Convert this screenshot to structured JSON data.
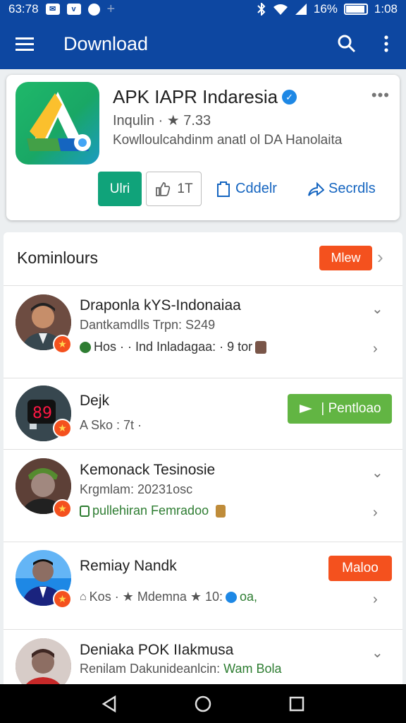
{
  "status_bar": {
    "left_text": "63:78",
    "battery": "16%",
    "time": "1:08"
  },
  "app_bar": {
    "title": "Download"
  },
  "app_card": {
    "name": "APK IAPR Indaresia",
    "meta": "Inqulin · ★ 7.33",
    "description": "Kowlloulcahdinm anatl ol⁠ DA Hanolaita",
    "install_label": "Ulri",
    "like_count": "1T",
    "action_1": "Cddelr",
    "action_2": "Secrdls"
  },
  "section": {
    "title": "Kominlours",
    "more_label": "Mlew"
  },
  "rows": [
    {
      "name": "Draponla kYS-Indonaiaa",
      "subtitle": "Dantkamdlls Trpn: S249",
      "tags": "Hos · · Ind Inladagaa: · 9 tor"
    },
    {
      "name": "Dejk",
      "subtitle": "A Sko : 7t ·",
      "button_label": "| Pentloao"
    },
    {
      "name": "Kemonack Tesinosie",
      "subtitle": "Krgmlam: 20231osc",
      "tags": "pullehiran Femradoo"
    },
    {
      "name": "Remiay Nandk",
      "subtitle": "Kos · ★ Mdemna ★ 10: ",
      "subtitle_tail": "oa,",
      "button_label": "Maloo"
    },
    {
      "name": "Deniaka POK IIakmusa",
      "subtitle": "Renilam Dakunideanlcin:",
      "subtitle_tail": "Wam Bola"
    }
  ],
  "colors": {
    "primary": "#0d47a1",
    "accent_orange": "#f4511e",
    "install_green": "#10a37a",
    "download_green": "#62b543",
    "link_blue": "#1565c0"
  },
  "icons": [
    "menu-icon",
    "search-icon",
    "overflow-icon",
    "verified-icon",
    "thumbs-up-icon",
    "bookmark-icon",
    "share-icon",
    "chevron-right-icon",
    "chevron-down-icon",
    "star-badge-icon",
    "back-icon",
    "home-icon",
    "recents-icon"
  ]
}
